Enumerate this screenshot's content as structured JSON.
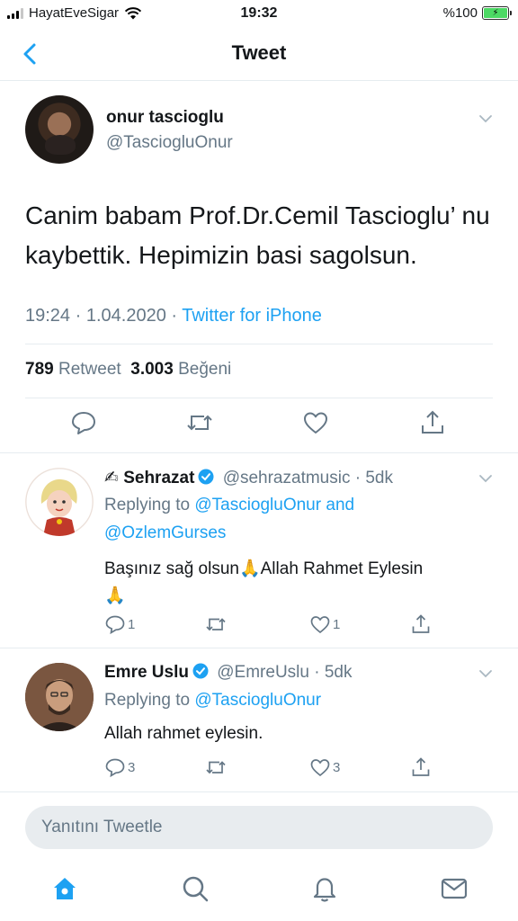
{
  "status_bar": {
    "carrier": "HayatEveSigar",
    "time": "19:32",
    "battery": "%100"
  },
  "header": {
    "title": "Tweet"
  },
  "tweet": {
    "author_name": "onur tascioglu",
    "author_handle": "@TasciogluOnur",
    "text": "Canim babam Prof.Dr.Cemil Tascioglu’ nu kaybettik. Hepimizin basi sagolsun.",
    "time": "19:24",
    "date": "1.04.2020",
    "source": "Twitter for iPhone",
    "retweet_count": "789",
    "retweet_label": "Retweet",
    "like_count": "3.003",
    "like_label": "Beğeni"
  },
  "replies": [
    {
      "name": "Sehrazat",
      "name_prefix": "✍",
      "handle": "@sehrazatmusic",
      "age": "5dk",
      "replying_prefix": "Replying to",
      "replying_to_1": "@TasciogluOnur",
      "replying_and": "and",
      "replying_to_2": "@OzlemGurses",
      "text_line1": "Başınız sağ olsun🙏Allah Rahmet Eylesin",
      "text_line2": "🙏",
      "reply_count": "1",
      "like_count": "1"
    },
    {
      "name": "Emre Uslu",
      "handle": "@EmreUslu",
      "age": "5dk",
      "replying_prefix": "Replying to",
      "replying_to_1": "@TasciogluOnur",
      "text_line1": "Allah rahmet eylesin.",
      "reply_count": "3",
      "like_count": "3"
    }
  ],
  "composer": {
    "placeholder": "Yanıtını Tweetle"
  },
  "colors": {
    "accent": "#1da1f2",
    "muted": "#657786",
    "text": "#14171a",
    "divider": "#e6ecf0"
  },
  "icons": {
    "tabs": [
      "home-icon",
      "search-icon",
      "bell-icon",
      "mail-icon"
    ],
    "actions": [
      "reply-icon",
      "retweet-icon",
      "like-icon",
      "share-icon"
    ]
  }
}
